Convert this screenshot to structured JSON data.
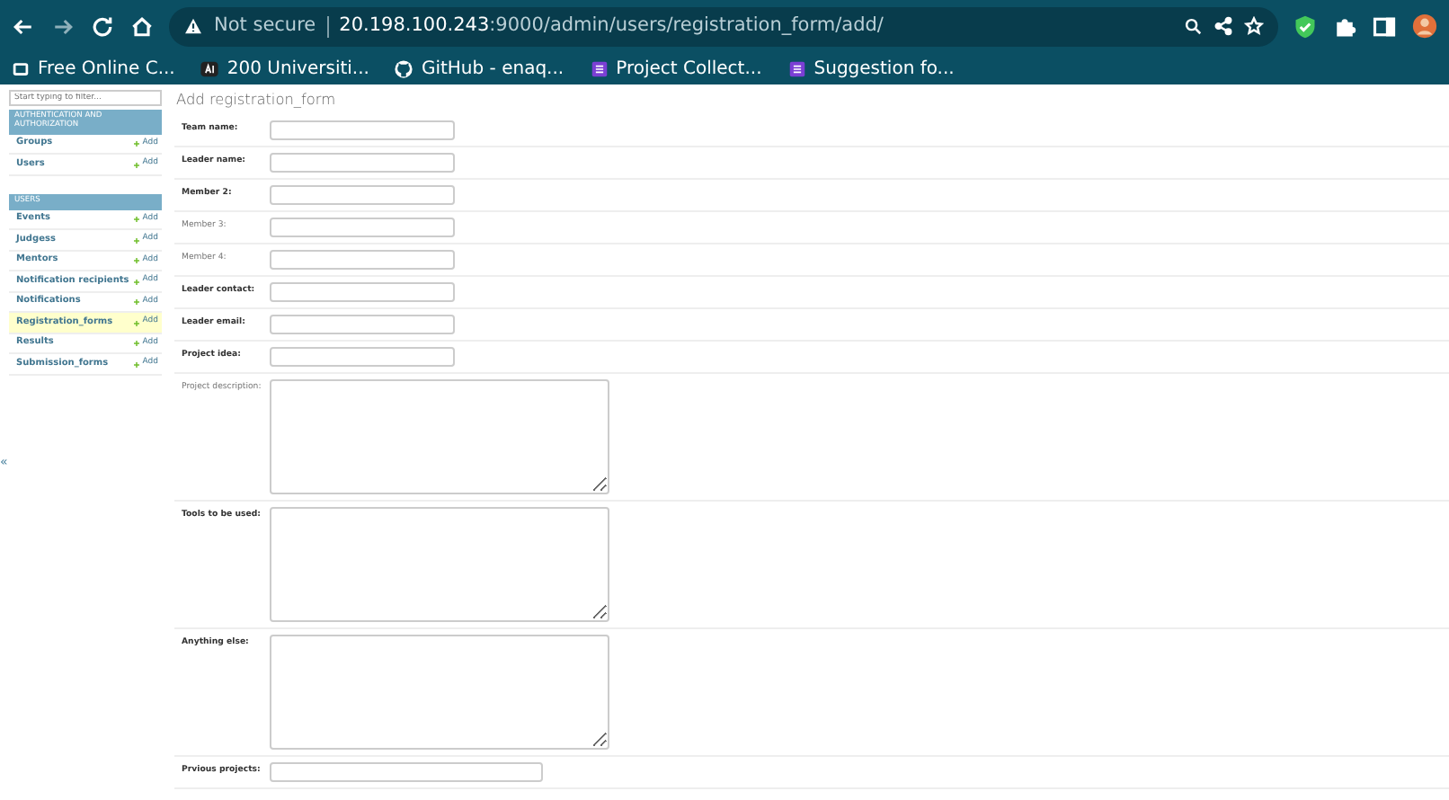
{
  "browser": {
    "security": "Not secure",
    "url_host": "20.198.100.243",
    "url_path": ":9000/admin/users/registration_form/add/",
    "bookmarks": [
      {
        "label": "Free Online C...",
        "kind": "screen"
      },
      {
        "label": "200 Universiti...",
        "kind": "ai"
      },
      {
        "label": "GitHub - enaq...",
        "kind": "github"
      },
      {
        "label": "Project Collect...",
        "kind": "form"
      },
      {
        "label": "Suggestion fo...",
        "kind": "form"
      }
    ]
  },
  "sidebar": {
    "filter_placeholder": "Start typing to filter...",
    "collapse": "«",
    "sections": [
      {
        "title": "AUTHENTICATION AND AUTHORIZATION",
        "items": [
          {
            "label": "Groups",
            "add": "Add",
            "selected": false
          },
          {
            "label": "Users",
            "add": "Add",
            "selected": false
          }
        ]
      },
      {
        "title": "USERS",
        "items": [
          {
            "label": "Events",
            "add": "Add",
            "selected": false
          },
          {
            "label": "Judgess",
            "add": "Add",
            "selected": false
          },
          {
            "label": "Mentors",
            "add": "Add",
            "selected": false
          },
          {
            "label": "Notification recipients",
            "add": "Add",
            "selected": false
          },
          {
            "label": "Notifications",
            "add": "Add",
            "selected": false
          },
          {
            "label": "Registration_forms",
            "add": "Add",
            "selected": true
          },
          {
            "label": "Results",
            "add": "Add",
            "selected": false
          },
          {
            "label": "Submission_forms",
            "add": "Add",
            "selected": false
          }
        ]
      }
    ]
  },
  "page_title": "Add registration_form",
  "fields": [
    {
      "label": "Team name:",
      "required": true,
      "kind": "input"
    },
    {
      "label": "Leader name:",
      "required": true,
      "kind": "input"
    },
    {
      "label": "Member 2:",
      "required": true,
      "kind": "input"
    },
    {
      "label": "Member 3:",
      "required": false,
      "kind": "input"
    },
    {
      "label": "Member 4:",
      "required": false,
      "kind": "input"
    },
    {
      "label": "Leader contact:",
      "required": true,
      "kind": "input"
    },
    {
      "label": "Leader email:",
      "required": true,
      "kind": "input"
    },
    {
      "label": "Project idea:",
      "required": true,
      "kind": "input"
    },
    {
      "label": "Project description:",
      "required": false,
      "kind": "textarea"
    },
    {
      "label": "Tools to be used:",
      "required": true,
      "kind": "textarea"
    },
    {
      "label": "Anything else:",
      "required": true,
      "kind": "textarea"
    },
    {
      "label": "Prvious projects:",
      "required": true,
      "kind": "wide"
    }
  ]
}
